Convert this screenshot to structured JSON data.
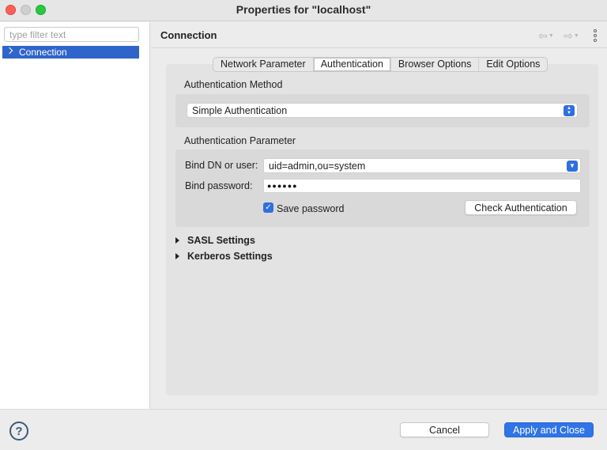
{
  "window": {
    "title": "Properties for \"localhost\""
  },
  "sidebar": {
    "filter_placeholder": "type filter text",
    "items": [
      {
        "label": "Connection",
        "selected": true
      }
    ]
  },
  "page": {
    "title": "Connection"
  },
  "tabs": [
    {
      "label": "Network Parameter",
      "active": false
    },
    {
      "label": "Authentication",
      "active": true
    },
    {
      "label": "Browser Options",
      "active": false
    },
    {
      "label": "Edit Options",
      "active": false
    }
  ],
  "auth_method": {
    "label": "Authentication Method",
    "selected": "Simple Authentication"
  },
  "auth_param": {
    "label": "Authentication Parameter",
    "bind_dn_label": "Bind DN or user:",
    "bind_dn_value": "uid=admin,ou=system",
    "bind_password_label": "Bind password:",
    "bind_password_value": "●●●●●●",
    "save_password_label": "Save password",
    "save_password_checked": true,
    "check_button": "Check Authentication"
  },
  "expanders": [
    {
      "label": "SASL Settings"
    },
    {
      "label": "Kerberos Settings"
    }
  ],
  "footer": {
    "cancel": "Cancel",
    "apply_close": "Apply and Close"
  },
  "icons": {
    "back": "arrow-left-icon",
    "forward": "arrow-right-icon",
    "menu": "vertical-dots-icon",
    "help": "help-icon"
  },
  "colors": {
    "accent": "#2f6fe0",
    "selection": "#2f65ca"
  }
}
